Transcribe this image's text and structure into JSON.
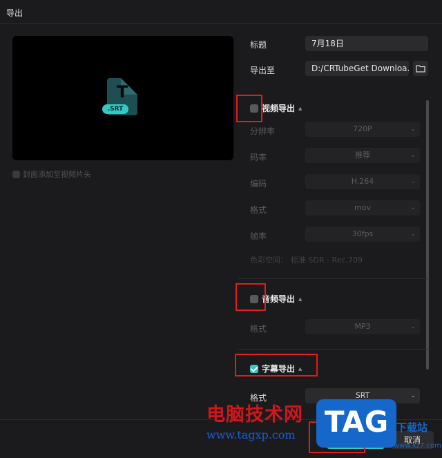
{
  "window": {
    "title": "导出"
  },
  "preview": {
    "file_badge": ".SRT",
    "file_letter": "T"
  },
  "cover": {
    "label": "封面添加至视频片头"
  },
  "form": {
    "title_label": "标题",
    "title_value": "7月18日",
    "export_to_label": "导出至",
    "export_to_value": "D:/CRTubeGet Downloa..."
  },
  "video_export": {
    "header": "视频导出",
    "checked": false,
    "rows": [
      {
        "label": "分辨率",
        "value": "720P"
      },
      {
        "label": "码率",
        "value": "推荐"
      },
      {
        "label": "编码",
        "value": "H.264"
      },
      {
        "label": "格式",
        "value": "mov"
      },
      {
        "label": "帧率",
        "value": "30fps"
      }
    ],
    "color_space_label": "色彩空间：",
    "color_space_value": "标准 SDR - Rec.709"
  },
  "audio_export": {
    "header": "音频导出",
    "checked": false,
    "format_label": "格式",
    "format_value": "MP3"
  },
  "subtitle_export": {
    "header": "字幕导出",
    "checked": true,
    "format_label": "格式",
    "format_value": "SRT"
  },
  "footer": {
    "export_label": "导出",
    "cancel_label": "取消"
  },
  "watermark": {
    "site_name": "电脑技术网",
    "url": "www.tagxp.com",
    "logo": "TAG",
    "right_text": "下载站",
    "right_url": "www.xz7.com"
  },
  "colors": {
    "accent": "#35c9c3",
    "highlight_box": "#e21b1b",
    "background": "#1b1b1d"
  }
}
